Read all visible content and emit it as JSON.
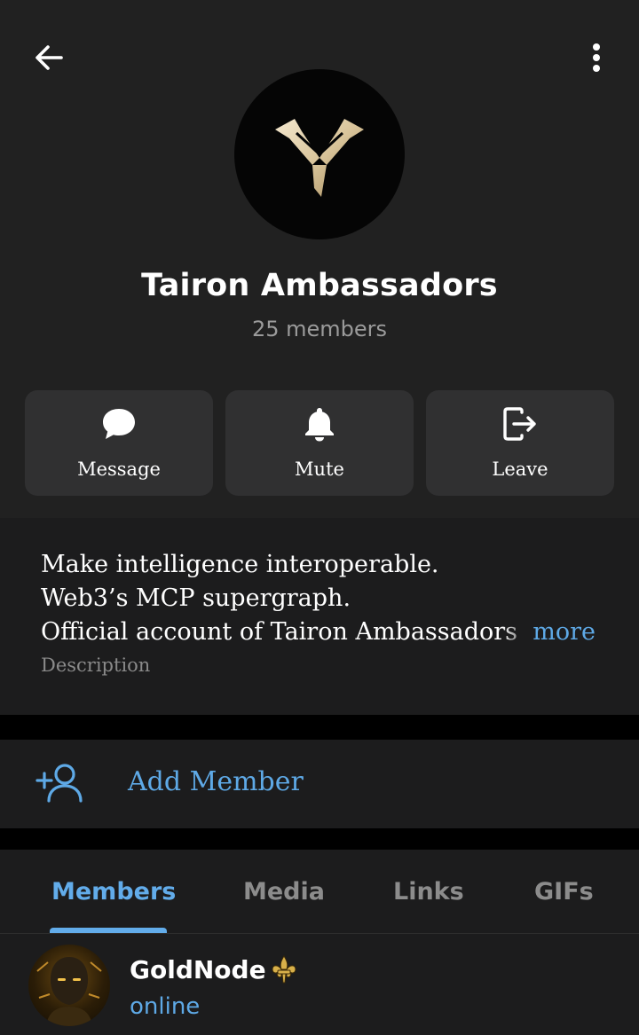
{
  "header": {
    "back_icon": "arrow-left-icon",
    "menu_icon": "more-vertical-icon"
  },
  "chat": {
    "title": "Tairon Ambassadors",
    "member_count": "25 members"
  },
  "actions": [
    {
      "label": "Message",
      "icon": "chat-bubble-icon"
    },
    {
      "label": "Mute",
      "icon": "bell-icon"
    },
    {
      "label": "Leave",
      "icon": "leave-icon"
    }
  ],
  "about": {
    "lines": [
      "Make intelligence interoperable.",
      "Web3’s MCP supergraph.",
      "Official account of Tairon Ambassadors"
    ],
    "more_label": "more",
    "caption": "Description"
  },
  "add_member": {
    "label": "Add Member",
    "icon": "add-user-icon"
  },
  "tabs": [
    {
      "label": "Members",
      "active": true
    },
    {
      "label": "Media",
      "active": false
    },
    {
      "label": "Links",
      "active": false
    },
    {
      "label": "GIFs",
      "active": false
    }
  ],
  "members": [
    {
      "name": "GoldNode",
      "badge_icon": "fleur-de-lis-icon",
      "status": "online"
    }
  ],
  "colors": {
    "accent": "#62acea",
    "header_bg": "#212121",
    "section_bg": "#1c1c1d",
    "button_bg": "#303031",
    "secondary_text": "#9b9b9b"
  }
}
